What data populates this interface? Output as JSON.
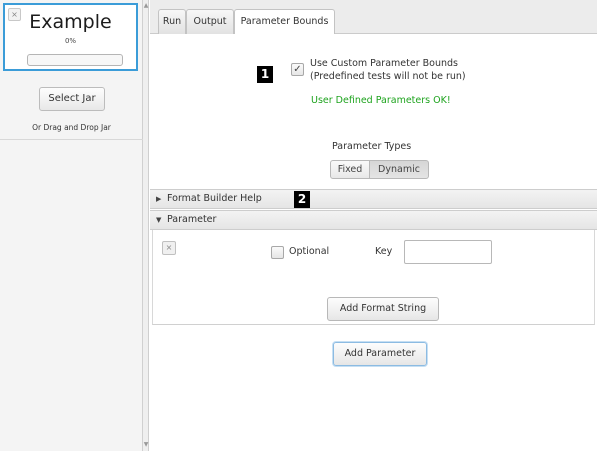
{
  "left_panel": {
    "card": {
      "close_icon": "×",
      "title": "Example",
      "percent": "0%",
      "progress": 0
    },
    "select_jar": "Select Jar",
    "drag_hint": "Or Drag and Drop Jar"
  },
  "tabs": [
    {
      "label": "Run",
      "active": false
    },
    {
      "label": "Output",
      "active": false
    },
    {
      "label": "Parameter Bounds",
      "active": true
    }
  ],
  "parameter_bounds": {
    "use_custom": {
      "checked": true,
      "check_glyph": "✓",
      "line1": "Use Custom Parameter Bounds",
      "line2": "(Predefined tests will not be run)"
    },
    "status": "User Defined Parameters OK!",
    "parameter_types": {
      "label": "Parameter Types",
      "options": [
        "Fixed",
        "Dynamic"
      ],
      "selected": "Dynamic"
    },
    "accordion": {
      "format_builder_help": {
        "label": "Format Builder Help",
        "expanded": false,
        "arrow": "▶"
      },
      "parameter": {
        "label": "Parameter",
        "expanded": true,
        "arrow": "▼"
      }
    },
    "parameter": {
      "close_icon": "×",
      "optional_label": "Optional",
      "optional_checked": false,
      "key_label": "Key",
      "key_value": "",
      "add_format_string": "Add Format String"
    },
    "add_parameter": "Add Parameter"
  },
  "markers": [
    "1",
    "2"
  ],
  "colors": {
    "accent": "#3b9cd8",
    "status_ok": "#1ea31e"
  }
}
